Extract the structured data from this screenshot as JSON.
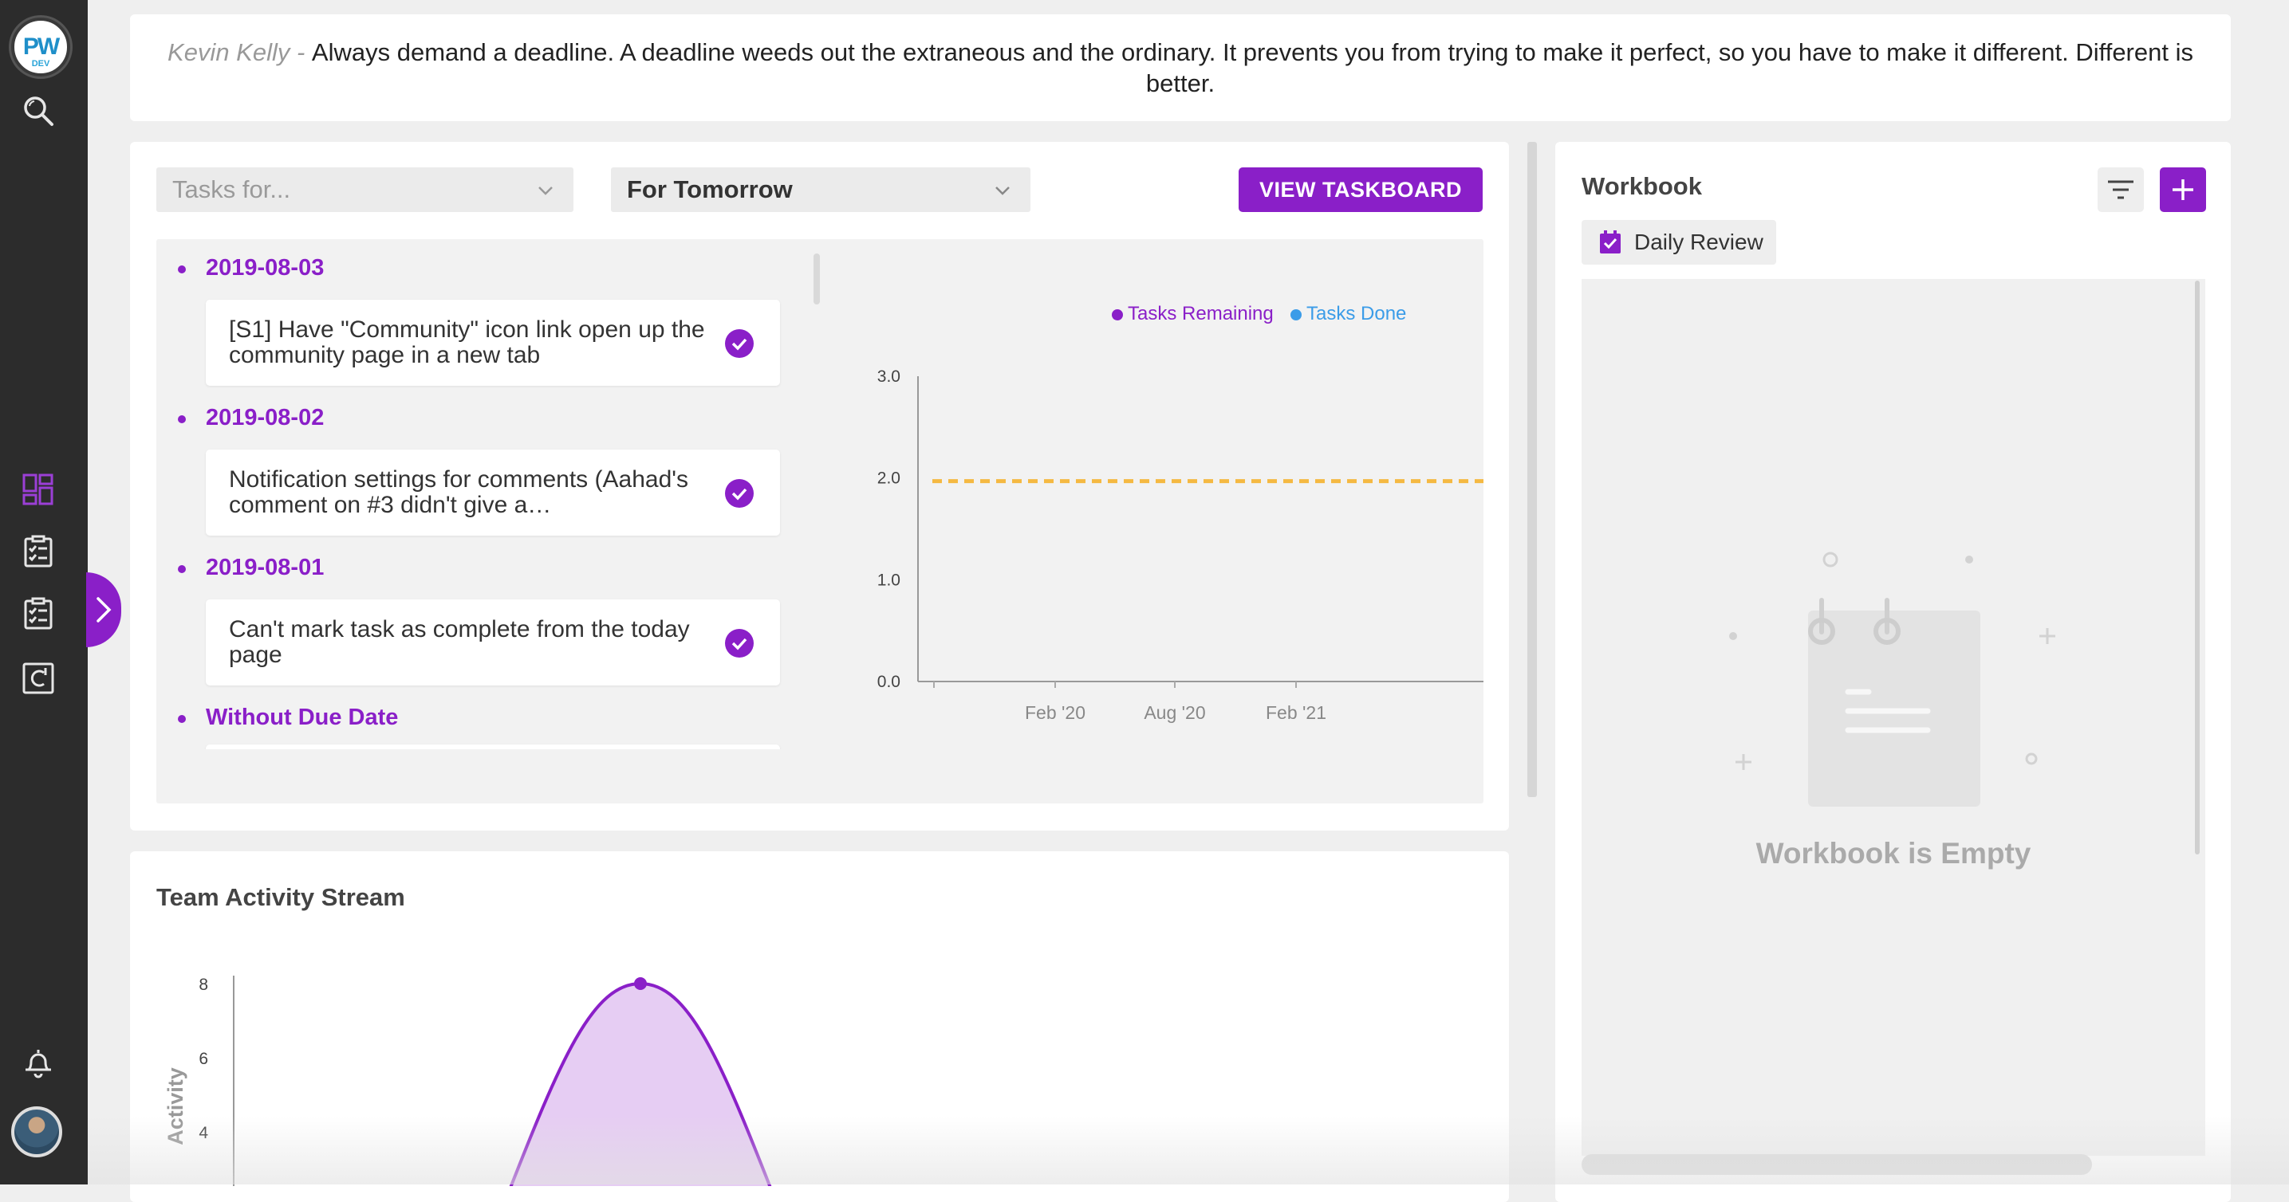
{
  "quote": {
    "author": "Kevin Kelly - ",
    "text": "Always demand a deadline. A deadline weeds out the extraneous and the ordinary. It prevents you from trying to make it perfect, so you have to make it different. Different is better."
  },
  "sidebar": {
    "logo_text": "PW",
    "logo_sub": "DEV",
    "items": [
      "search",
      "dashboard",
      "tasks",
      "checklist",
      "calendar"
    ],
    "accent": "#8a1fc8"
  },
  "tasks": {
    "filter_placeholder": "Tasks for...",
    "period_selected": "For Tomorrow",
    "view_taskboard_label": "VIEW TASKBOARD",
    "groups": [
      {
        "date": "2019-08-03",
        "task": "[S1] Have \"Community\" icon link open up the community page in a new tab"
      },
      {
        "date": "2019-08-02",
        "task": "Notification settings for comments (Aahad's comment on #3 didn't give a…"
      },
      {
        "date": "2019-08-01",
        "task": "Can't mark task as complete from the today page"
      },
      {
        "date": "Without Due Date",
        "task": ""
      }
    ]
  },
  "chart_data": [
    {
      "type": "line",
      "title": "",
      "series": [
        {
          "name": "Tasks Remaining",
          "color": "#8a1fc8",
          "values": []
        },
        {
          "name": "Tasks Done",
          "color": "#3b9ce8",
          "values": []
        }
      ],
      "reference_line": {
        "value": 2.0,
        "color": "#f5b942",
        "style": "dashed"
      },
      "y_ticks": [
        "0.0",
        "1.0",
        "2.0",
        "3.0"
      ],
      "x_ticks": [
        "Feb '20",
        "Aug '20",
        "Feb '21"
      ],
      "ylim": [
        0,
        3
      ],
      "legend_position": "top-right",
      "grid": false
    },
    {
      "type": "area",
      "title": "Team Activity Stream",
      "ylabel": "Activity",
      "y_ticks": [
        "4",
        "6",
        "8"
      ],
      "peak_value": 8,
      "color": "#8a1fc8"
    }
  ],
  "activity": {
    "title": "Team Activity Stream",
    "ylabel": "Activity"
  },
  "workbook": {
    "title": "Workbook",
    "tab_label": "Daily Review",
    "empty_text": "Workbook is Empty"
  }
}
